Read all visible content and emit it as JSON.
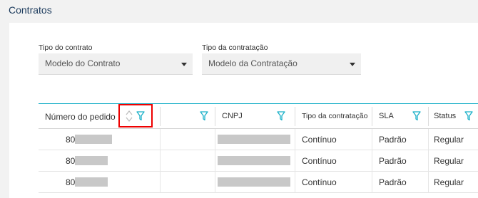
{
  "page": {
    "title": "Contratos"
  },
  "filters": {
    "contract_type": {
      "label": "Tipo do contrato",
      "value": "Modelo do Contrato"
    },
    "hire_type": {
      "label": "Tipo da contratação",
      "value": "Modelo da Contratação"
    }
  },
  "table": {
    "columns": [
      "Número do pedido",
      "",
      "CNPJ",
      "Tipo da contratação",
      "SLA",
      "Status"
    ],
    "rows": [
      {
        "pedido_prefix": "80",
        "tipo": "Contínuo",
        "sla": "Padrão",
        "status": "Regular"
      },
      {
        "pedido_prefix": "80",
        "tipo": "Contínuo",
        "sla": "Padrão",
        "status": "Regular"
      },
      {
        "pedido_prefix": "80",
        "tipo": "Contínuo",
        "sla": "Padrão",
        "status": "Regular"
      }
    ]
  },
  "colors": {
    "accent": "#19b0c8",
    "highlight": "#e00000",
    "title": "#1b3a5c"
  },
  "icons": [
    "sort-icon",
    "filter-icon",
    "chevron-down-icon"
  ]
}
